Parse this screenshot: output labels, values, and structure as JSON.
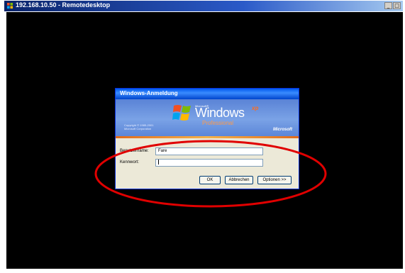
{
  "window": {
    "title": "192.168.10.50 - Remotedesktop",
    "buttons": {
      "minimize": "_",
      "maximize": "□"
    }
  },
  "dialog": {
    "title": "Windows-Anmeldung",
    "banner": {
      "brand_small": "Microsoft®",
      "brand_name": "Windows",
      "brand_xp": "xp",
      "edition": "Professional",
      "copyright_line1": "Copyright © 1985-2001",
      "copyright_line2": "Microsoft Corporation",
      "microsoft": "Microsoft"
    },
    "username": {
      "label": "Benutzername:",
      "value": "Fare"
    },
    "password": {
      "label": "Kennwort:",
      "value": ""
    },
    "buttons": {
      "ok": "OK",
      "cancel": "Abbrechen",
      "options": "Optionen >>"
    }
  },
  "annotation": {
    "color": "#e00000"
  },
  "colors": {
    "desktop": "#000000",
    "dialog_title": "#0058ee",
    "banner": "#5a83d6"
  }
}
